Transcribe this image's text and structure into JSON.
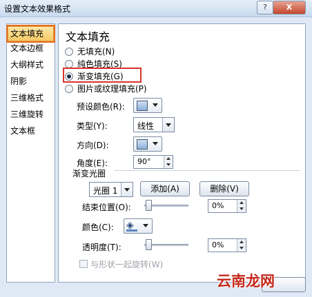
{
  "window": {
    "title": "设置文本效果格式",
    "help_label": "?",
    "close_label": "X"
  },
  "nav": {
    "items": [
      {
        "label": "文本填充",
        "selected": true
      },
      {
        "label": "文本边框",
        "selected": false
      },
      {
        "label": "大纲样式",
        "selected": false
      },
      {
        "label": "阴影",
        "selected": false
      },
      {
        "label": "三维格式",
        "selected": false
      },
      {
        "label": "三维旋转",
        "selected": false
      },
      {
        "label": "文本框",
        "selected": false
      }
    ]
  },
  "panel": {
    "title": "文本填充",
    "fill_options": [
      {
        "label": "无填充(N)",
        "checked": false
      },
      {
        "label": "纯色填充(S)",
        "checked": false
      },
      {
        "label": "渐变填充(G)",
        "checked": true
      },
      {
        "label": "图片或纹理填充(P)",
        "checked": false
      }
    ],
    "preset_label": "预设颜色(R):",
    "type_label": "类型(Y):",
    "type_value": "线性",
    "direction_label": "方向(D):",
    "angle_label": "角度(E):",
    "angle_value": "90°",
    "stops_group_label": "渐变光圈",
    "stop_select_value": "光圈 1",
    "add_button": "添加(A)",
    "delete_button": "删除(V)",
    "end_position_label": "结束位置(O):",
    "end_position_value": "0%",
    "color_label": "颜色(C):",
    "transparency_label": "透明度(T):",
    "transparency_value": "0%",
    "rotate_with_shape_label": "与形状一起旋转(W)"
  },
  "watermark": "云南龙网",
  "colors": {
    "selection_outline": "#e06d20",
    "highlight_box": "#d8322b",
    "watermark": "#c4291c"
  }
}
